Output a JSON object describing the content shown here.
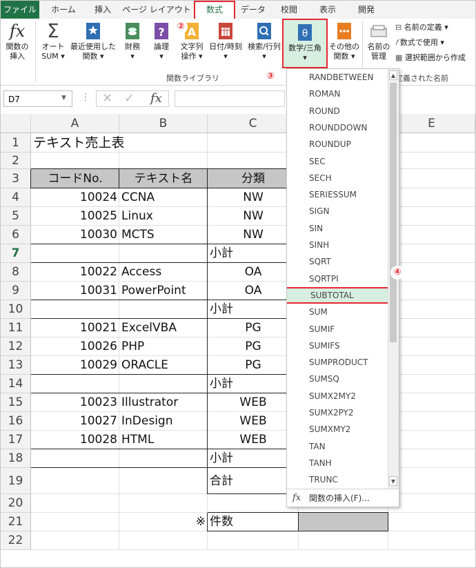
{
  "tabs": [
    "ファイル",
    "ホーム",
    "挿入",
    "ページ レイアウト",
    "数式",
    "データ",
    "校閲",
    "表示",
    "開発"
  ],
  "ribbon": {
    "insert_func": "関数の\n挿入",
    "autosum": "オート\nSUM ▾",
    "recent": "最近使用した\n関数 ▾",
    "financial": "財務\n▾",
    "logical": "論理\n▾",
    "text": "文字列\n操作 ▾",
    "datetime": "日付/時刻\n▾",
    "lookup": "検索/行列\n▾",
    "math": "数学/三角\n▾",
    "other": "その他の\n関数 ▾",
    "name_mgr": "名前の\n管理",
    "define_name": "名前の定義 ▾",
    "use_in_formula": "数式で使用 ▾",
    "create_from_sel": "選択範囲から作成",
    "group_library": "関数ライブラリ",
    "group_names": "定義された名前",
    "marker2": "②",
    "marker3": "③",
    "marker4": "④"
  },
  "formula_bar": {
    "namebox": "D7",
    "fx": "fx"
  },
  "columns": [
    "A",
    "B",
    "C",
    "E"
  ],
  "rows": [
    "1",
    "2",
    "3",
    "4",
    "5",
    "6",
    "7",
    "8",
    "9",
    "10",
    "11",
    "12",
    "13",
    "14",
    "15",
    "16",
    "17",
    "18",
    "19",
    "20",
    "21",
    "22"
  ],
  "sheet": {
    "title": "テキスト売上表",
    "hdr_code": "コードNo.",
    "hdr_name": "テキスト名",
    "hdr_cat": "分類",
    "data": [
      {
        "code": "10024",
        "name": "CCNA",
        "cat": "NW"
      },
      {
        "code": "10025",
        "name": "Linux",
        "cat": "NW"
      },
      {
        "code": "10030",
        "name": "MCTS",
        "cat": "NW"
      },
      {
        "code": "10022",
        "name": "Access",
        "cat": "OA"
      },
      {
        "code": "10031",
        "name": "PowerPoint",
        "cat": "OA"
      },
      {
        "code": "10021",
        "name": "ExcelVBA",
        "cat": "PG"
      },
      {
        "code": "10026",
        "name": "PHP",
        "cat": "PG"
      },
      {
        "code": "10029",
        "name": "ORACLE",
        "cat": "PG"
      },
      {
        "code": "10023",
        "name": "Illustrator",
        "cat": "WEB"
      },
      {
        "code": "10027",
        "name": "InDesign",
        "cat": "WEB"
      },
      {
        "code": "10028",
        "name": "HTML",
        "cat": "WEB"
      }
    ],
    "subtotal": "小計",
    "total": "合計",
    "note_mark": "※",
    "count": "件数"
  },
  "dropdown": {
    "items": [
      "RANDBETWEEN",
      "ROMAN",
      "ROUND",
      "ROUNDDOWN",
      "ROUNDUP",
      "SEC",
      "SECH",
      "SERIESSUM",
      "SIGN",
      "SIN",
      "SINH",
      "SQRT",
      "SQRTPI",
      "SUBTOTAL",
      "SUM",
      "SUMIF",
      "SUMIFS",
      "SUMPRODUCT",
      "SUMSQ",
      "SUMX2MY2",
      "SUMX2PY2",
      "SUMXMY2",
      "TAN",
      "TANH",
      "TRUNC"
    ],
    "selected": "SUBTOTAL",
    "footer": "関数の挿入(F)..."
  },
  "colors": {
    "accent": "#217346",
    "highlight": "#e8262e",
    "selected_bg": "#d7efe1"
  }
}
